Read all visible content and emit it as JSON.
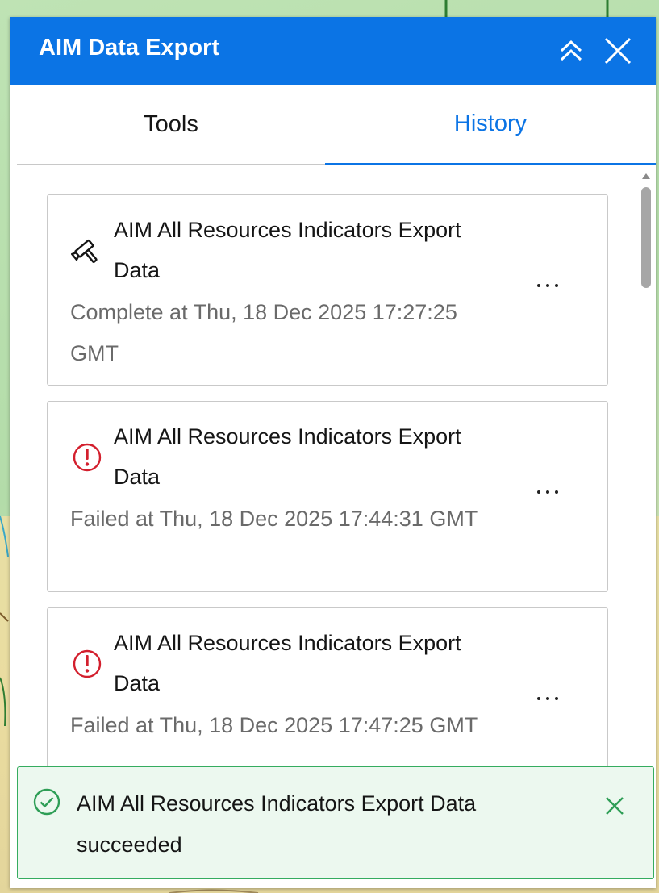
{
  "panel": {
    "title": "AIM Data Export",
    "colors": {
      "header": "#0b74e5",
      "accent": "#0b74e5",
      "error": "#d31f2d",
      "success": "#2e9e56"
    }
  },
  "header_actions": {
    "collapse_icon": "double-chevron-up-icon",
    "close_icon": "close-icon"
  },
  "tabs": [
    {
      "label": "Tools",
      "active": false
    },
    {
      "label": "History",
      "active": true
    }
  ],
  "history": [
    {
      "title": "AIM All Resources Indicators Export Data",
      "status_text": "Complete at Thu, 18 Dec 2025 17:27:25 GMT",
      "status": "complete",
      "icon": "hammer-icon"
    },
    {
      "title": "AIM All Resources Indicators Export Data",
      "status_text": "Failed at Thu, 18 Dec 2025 17:44:31 GMT",
      "status": "failed",
      "icon": "error-icon"
    },
    {
      "title": "AIM All Resources Indicators Export Data",
      "status_text": "Failed at Thu, 18 Dec 2025 17:47:25 GMT",
      "status": "failed",
      "icon": "error-icon"
    }
  ],
  "toast": {
    "message": "AIM All Resources Indicators Export Data succeeded",
    "icon": "check-circle-icon",
    "close_icon": "close-icon"
  }
}
